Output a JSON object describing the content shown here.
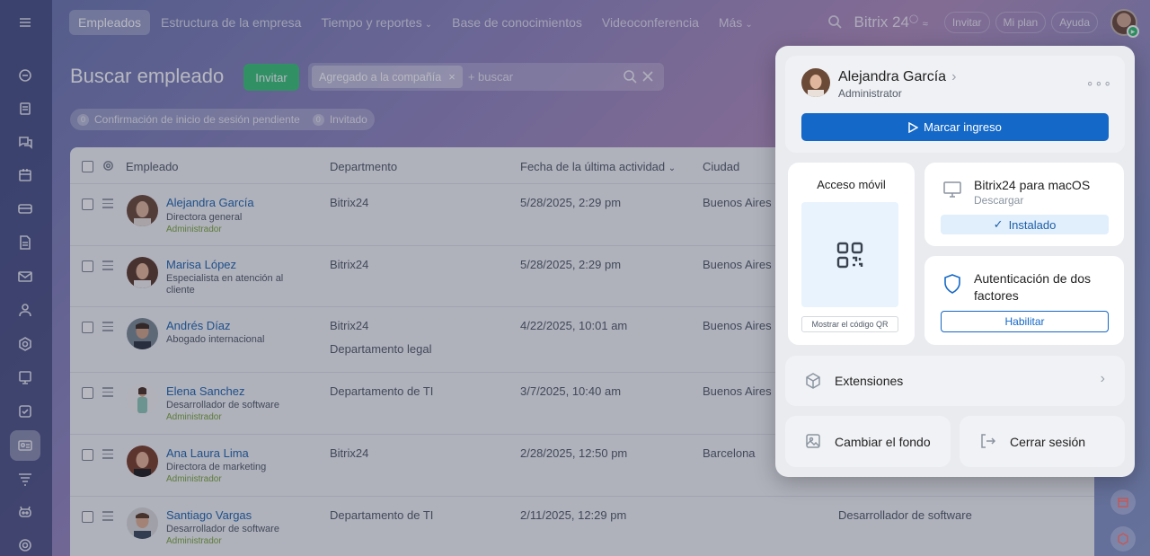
{
  "nav": {
    "tabs": [
      {
        "label": "Empleados"
      },
      {
        "label": "Estructura de la empresa"
      },
      {
        "label": "Tiempo y reportes"
      },
      {
        "label": "Base de conocimientos"
      },
      {
        "label": "Videoconferencia"
      },
      {
        "label": "Más"
      }
    ]
  },
  "topbar": {
    "brand": "Bitrix 24",
    "invite": "Invitar",
    "plan": "Mi plan",
    "help": "Ayuda"
  },
  "page": {
    "title": "Buscar empleado",
    "invite_button": "Invitar",
    "filter_chip": "Agregado a la compañía",
    "search_placeholder": "+ buscar",
    "counters": [
      {
        "num": "0",
        "label": "Confirmación de inicio de sesión pendiente"
      },
      {
        "num": "0",
        "label": "Invitado"
      }
    ]
  },
  "table": {
    "headers": {
      "employee": "Empleado",
      "department": "Departmento",
      "last_activity": "Fecha de la última actividad",
      "city": "Ciudad"
    },
    "rows": [
      {
        "name": "Alejandra García",
        "position": "Directora general",
        "role": "Administrador",
        "dept": "Bitrix24",
        "dept2": "",
        "date": "5/28/2025, 2:29 pm",
        "city": "Buenos Aires",
        "extra": ""
      },
      {
        "name": "Marisa López",
        "position": "Especialista en atención al cliente",
        "role": "",
        "dept": "Bitrix24",
        "dept2": "",
        "date": "5/28/2025, 2:29 pm",
        "city": "Buenos Aires",
        "extra": ""
      },
      {
        "name": "Andrés Díaz",
        "position": "Abogado internacional",
        "role": "",
        "dept": "Bitrix24",
        "dept2": "Departamento legal",
        "date": "4/22/2025, 10:01 am",
        "city": "Buenos Aires",
        "extra": ""
      },
      {
        "name": "Elena Sanchez",
        "position": "Desarrollador de software",
        "role": "Administrador",
        "dept": "Departamento de TI",
        "dept2": "",
        "date": "3/7/2025, 10:40 am",
        "city": "Buenos Aires",
        "extra": ""
      },
      {
        "name": "Ana Laura Lima",
        "position": "Directora de marketing",
        "role": "Administrador",
        "dept": "Bitrix24",
        "dept2": "",
        "date": "2/28/2025, 12:50 pm",
        "city": "Barcelona",
        "extra": ""
      },
      {
        "name": "Santiago Vargas",
        "position": "Desarrollador de software",
        "role": "Administrador",
        "dept": "Departamento de TI",
        "dept2": "",
        "date": "2/11/2025, 12:29 pm",
        "city": "",
        "extra": "Desarrollador de software"
      }
    ]
  },
  "panel": {
    "user_name": "Alejandra García",
    "user_role": "Administrator",
    "checkin": "Marcar ingreso",
    "mobile_title": "Acceso móvil",
    "qr_button": "Mostrar el código QR",
    "mac_title": "Bitrix24 para macOS",
    "mac_sub": "Descargar",
    "mac_installed": "Instalado",
    "twofa_title": "Autenticación de dos factores",
    "twofa_button": "Habilitar",
    "extensions": "Extensiones",
    "change_bg": "Cambiar el fondo",
    "logout": "Cerrar sesión"
  },
  "colors": {
    "accent": "#1468c7",
    "invite_green": "#3bc47a",
    "role_green": "#7ca83a",
    "link_blue": "#2067b0"
  }
}
